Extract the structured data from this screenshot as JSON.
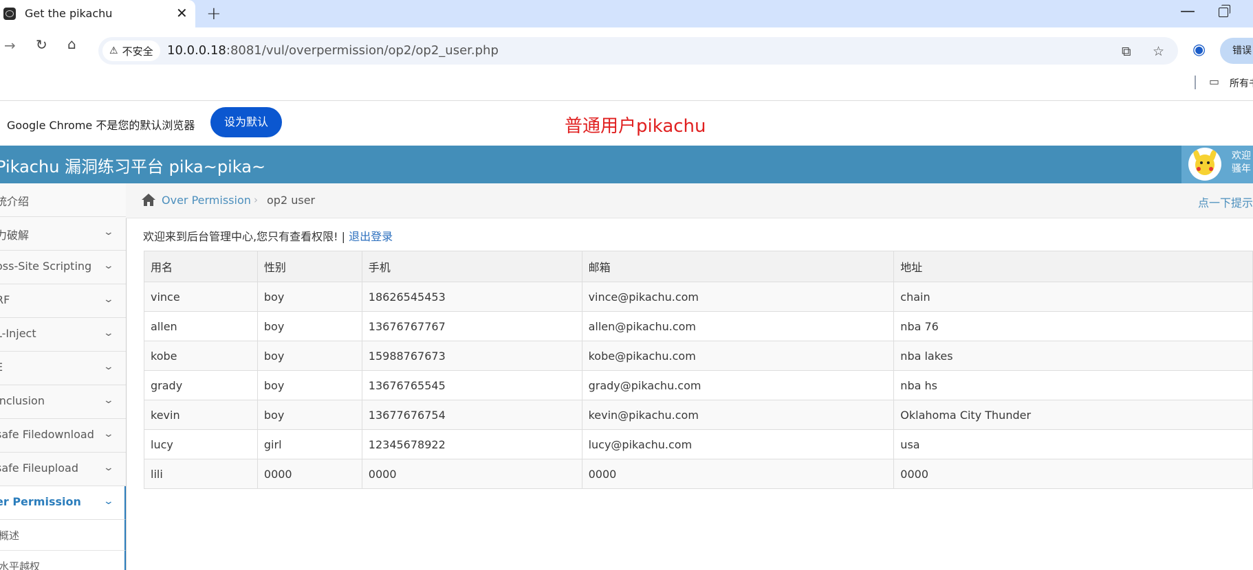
{
  "browser": {
    "tab_title": "Get the pikachu",
    "security_label": "不安全",
    "url_host": "10.0.0.18",
    "url_rest": ":8081/vul/overpermission/op2/op2_user.php",
    "error_button": "错误",
    "bookmarks_label": "所有书签"
  },
  "infobar": {
    "message": "Google Chrome 不是您的默认浏览器",
    "set_default": "设为默认"
  },
  "annotation": {
    "user_label": "普通用户pikachu"
  },
  "app": {
    "title": "Pikachu 漏洞练习平台 pika~pika~",
    "welcome_line1": "欢迎",
    "welcome_line2": "骚年"
  },
  "sidebar": {
    "items": [
      {
        "label": "统介绍",
        "has_chevron": false
      },
      {
        "label": "力破解",
        "has_chevron": true
      },
      {
        "label": "oss-Site Scripting",
        "has_chevron": true
      },
      {
        "label": "RF",
        "has_chevron": true
      },
      {
        "label": "L-Inject",
        "has_chevron": true
      },
      {
        "label": "E",
        "has_chevron": true
      },
      {
        "label": " Inclusion",
        "has_chevron": true
      },
      {
        "label": "safe Filedownload",
        "has_chevron": true
      },
      {
        "label": "safe Fileupload",
        "has_chevron": true
      },
      {
        "label": "er Permission",
        "has_chevron": true,
        "active": true
      }
    ],
    "subitems": [
      {
        "label": "概述"
      },
      {
        "label": "水平越权"
      }
    ]
  },
  "breadcrumb": {
    "parent": "Over Permission",
    "current": "op2 user",
    "hint": "点一下提示"
  },
  "main": {
    "welcome_text": "欢迎来到后台管理中心,您只有查看权限! | ",
    "logout": "退出登录",
    "table": {
      "headers": [
        "用名",
        "性别",
        "手机",
        "邮箱",
        "地址"
      ],
      "rows": [
        [
          "vince",
          "boy",
          "18626545453",
          "vince@pikachu.com",
          "chain"
        ],
        [
          "allen",
          "boy",
          "13676767767",
          "allen@pikachu.com",
          "nba 76"
        ],
        [
          "kobe",
          "boy",
          "15988767673",
          "kobe@pikachu.com",
          "nba lakes"
        ],
        [
          "grady",
          "boy",
          "13676765545",
          "grady@pikachu.com",
          "nba hs"
        ],
        [
          "kevin",
          "boy",
          "13677676754",
          "kevin@pikachu.com",
          "Oklahoma City Thunder"
        ],
        [
          "lucy",
          "girl",
          "12345678922",
          "lucy@pikachu.com",
          "usa"
        ],
        [
          "lili",
          "0000",
          "0000",
          "0000",
          "0000"
        ]
      ]
    }
  },
  "colors": {
    "header_bg": "#438eb9",
    "accent": "#2b7dbc",
    "user_label": "#e02020",
    "primary_button": "#0b57d0"
  }
}
